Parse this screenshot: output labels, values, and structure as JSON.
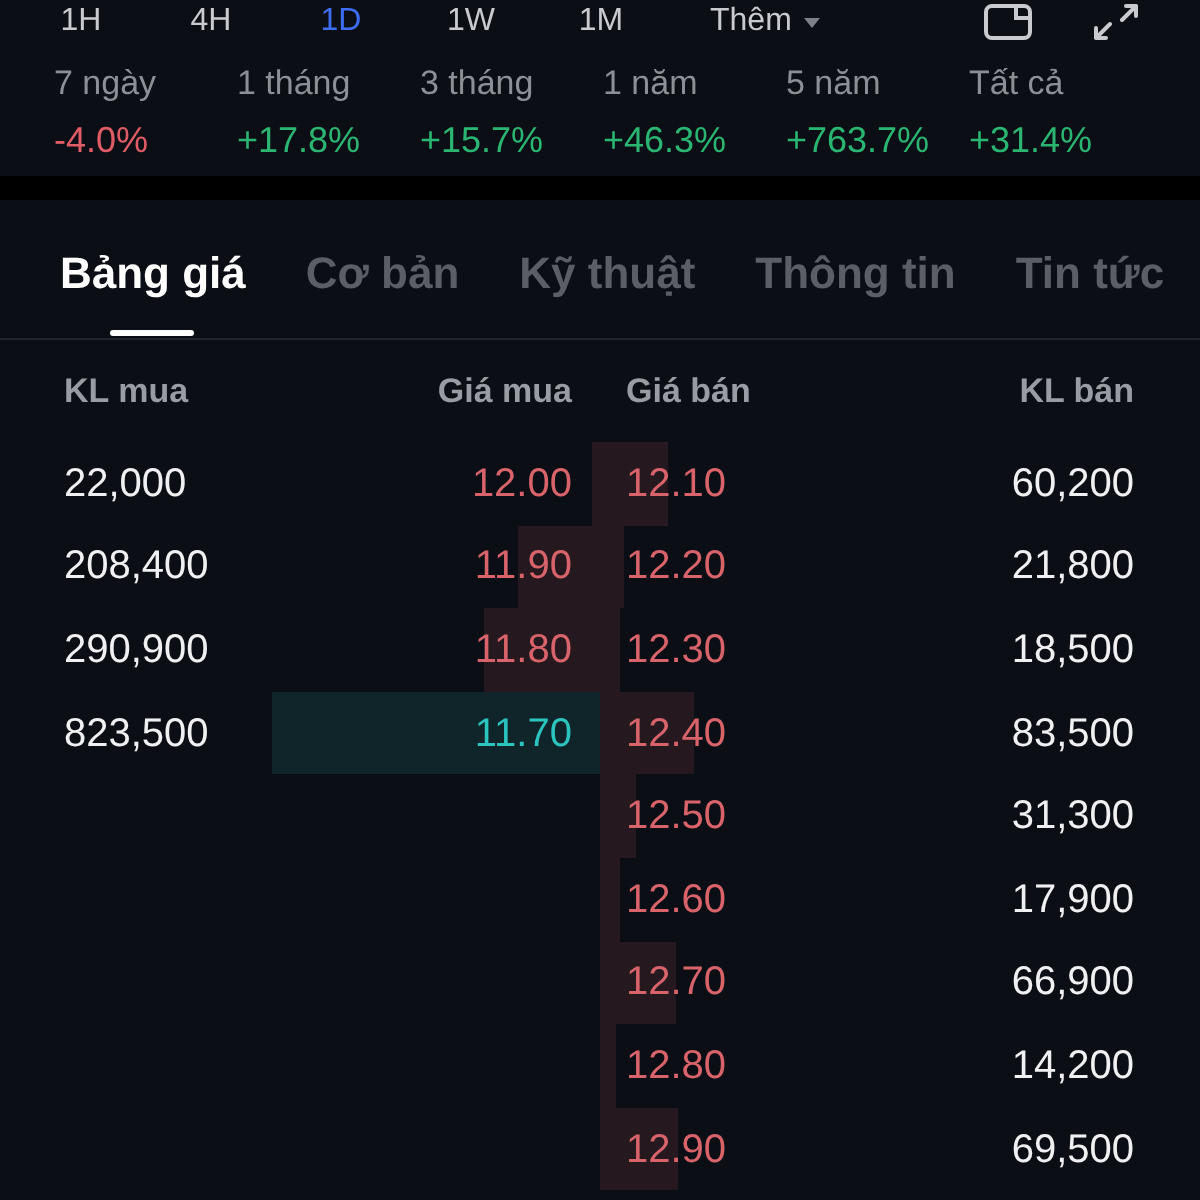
{
  "timeframes": [
    {
      "label": "1H",
      "selected": false
    },
    {
      "label": "4H",
      "selected": false
    },
    {
      "label": "1D",
      "selected": true
    },
    {
      "label": "1W",
      "selected": false
    },
    {
      "label": "1M",
      "selected": false
    }
  ],
  "more_button": {
    "label": "Thêm"
  },
  "performance": [
    {
      "period": "7 ngày",
      "change": "-4.0%",
      "color": "#e05c67"
    },
    {
      "period": "1 tháng",
      "change": "+17.8%",
      "color": "#2ab672"
    },
    {
      "period": "3 tháng",
      "change": "+15.7%",
      "color": "#2ab672"
    },
    {
      "period": "1 năm",
      "change": "+46.3%",
      "color": "#2ab672"
    },
    {
      "period": "5 năm",
      "change": "+763.7%",
      "color": "#2ab672"
    },
    {
      "period": "Tất cả",
      "change": "+31.4%",
      "color": "#2ab672"
    }
  ],
  "tabs": [
    {
      "label": "Bảng giá",
      "selected": true
    },
    {
      "label": "Cơ bản",
      "selected": false
    },
    {
      "label": "Kỹ thuật",
      "selected": false
    },
    {
      "label": "Thông tin",
      "selected": false
    },
    {
      "label": "Tin tức",
      "selected": false
    }
  ],
  "order_book": {
    "columns": {
      "bid_volume": "KL mua",
      "bid_price": "Giá mua",
      "ask_price": "Giá bán",
      "ask_volume": "KL bán"
    },
    "bids": [
      {
        "volume": "22,000",
        "price": "12.00",
        "color": "#d8636b"
      },
      {
        "volume": "208,400",
        "price": "11.90",
        "color": "#d8636b"
      },
      {
        "volume": "290,900",
        "price": "11.80",
        "color": "#d8636b"
      },
      {
        "volume": "823,500",
        "price": "11.70",
        "color": "#2cc4be"
      }
    ],
    "asks": [
      {
        "price": "12.10",
        "volume": "60,200",
        "color": "#d8636b"
      },
      {
        "price": "12.20",
        "volume": "21,800",
        "color": "#d8636b"
      },
      {
        "price": "12.30",
        "volume": "18,500",
        "color": "#d8636b"
      },
      {
        "price": "12.40",
        "volume": "83,500",
        "color": "#d8636b"
      },
      {
        "price": "12.50",
        "volume": "31,300",
        "color": "#d8636b"
      },
      {
        "price": "12.60",
        "volume": "17,900",
        "color": "#d8636b"
      },
      {
        "price": "12.70",
        "volume": "66,900",
        "color": "#d8636b"
      },
      {
        "price": "12.80",
        "volume": "14,200",
        "color": "#d8636b"
      },
      {
        "price": "12.90",
        "volume": "69,500",
        "color": "#d8636b"
      }
    ]
  }
}
